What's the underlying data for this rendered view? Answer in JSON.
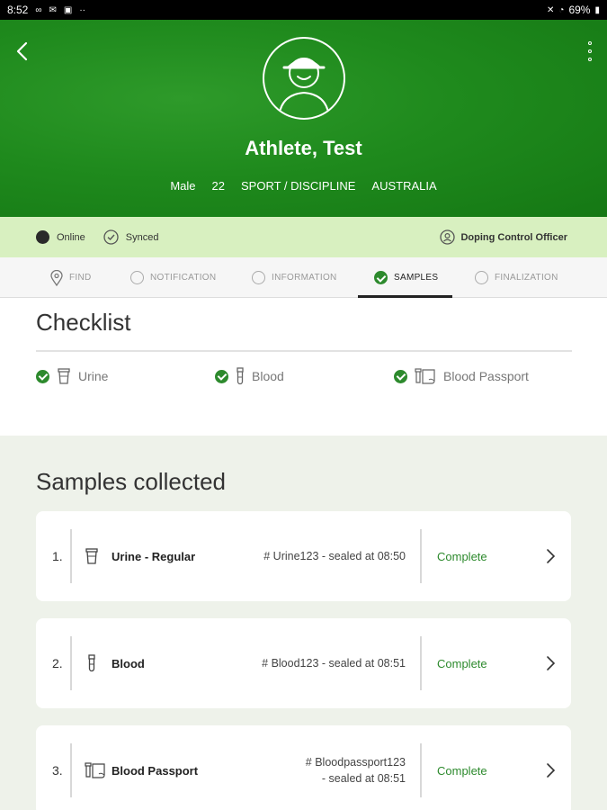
{
  "status_bar": {
    "time": "8:52",
    "battery": "69%"
  },
  "athlete": {
    "name": "Athlete, Test",
    "gender": "Male",
    "age": "22",
    "sport": "SPORT / DISCIPLINE",
    "country": "AUSTRALIA"
  },
  "info_bar": {
    "online": "Online",
    "synced": "Synced",
    "role": "Doping Control Officer"
  },
  "tabs": [
    {
      "label": "FIND",
      "icon": "location-pin-icon"
    },
    {
      "label": "NOTIFICATION",
      "icon": "empty-circle-icon"
    },
    {
      "label": "INFORMATION",
      "icon": "empty-circle-icon"
    },
    {
      "label": "SAMPLES",
      "icon": "check-circle-icon",
      "active": true
    },
    {
      "label": "FINALIZATION",
      "icon": "empty-circle-icon"
    }
  ],
  "checklist": {
    "title": "Checklist",
    "items": [
      {
        "label": "Urine",
        "icon": "urine-cup-icon"
      },
      {
        "label": "Blood",
        "icon": "blood-tube-icon"
      },
      {
        "label": "Blood Passport",
        "icon": "blood-passport-icon"
      }
    ]
  },
  "samples": {
    "title": "Samples collected",
    "items": [
      {
        "index": "1.",
        "name": "Urine - Regular",
        "code_line1": "# Urine123 - sealed at 08:50",
        "code_line2": "",
        "status": "Complete",
        "icon": "urine-cup-icon"
      },
      {
        "index": "2.",
        "name": "Blood",
        "code_line1": "# Blood123 - sealed at 08:51",
        "code_line2": "",
        "status": "Complete",
        "icon": "blood-tube-icon"
      },
      {
        "index": "3.",
        "name": "Blood Passport",
        "code_line1": "# Bloodpassport123",
        "code_line2": "- sealed at 08:51",
        "status": "Complete",
        "icon": "blood-passport-icon"
      }
    ]
  },
  "colors": {
    "header_green": "#1f8a1d",
    "status_green": "#2d8a2d",
    "info_bar": "#d8f0c0",
    "samples_bg": "#eef2ea"
  }
}
